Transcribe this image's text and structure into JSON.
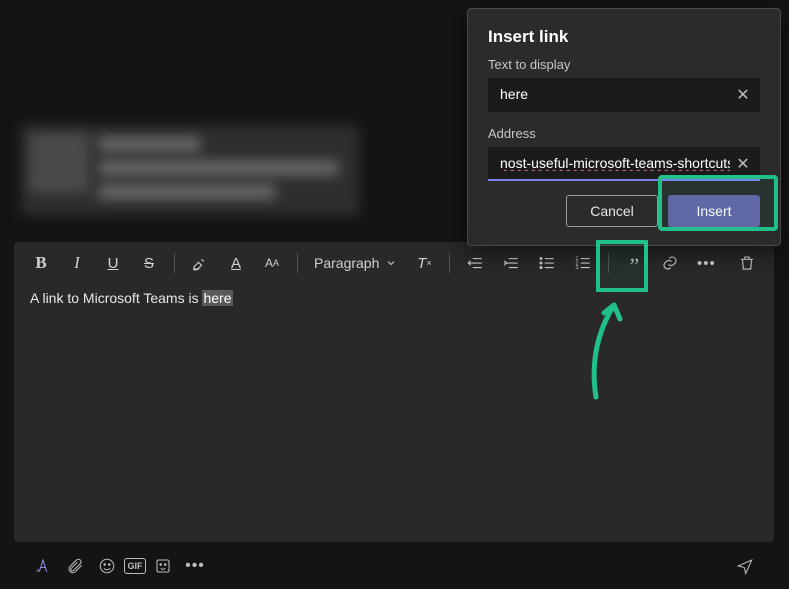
{
  "header_blur": true,
  "dialog": {
    "title": "Insert link",
    "text_label": "Text to display",
    "text_value": "here",
    "address_label": "Address",
    "address_value": "nost-useful-microsoft-teams-shortcuts/",
    "cancel_label": "Cancel",
    "insert_label": "Insert"
  },
  "toolbar": {
    "paragraph_label": "Paragraph"
  },
  "editor": {
    "text_before": "A link to Microsoft Teams is ",
    "selected_text": "here"
  },
  "annotation": {
    "highlight_insert": true,
    "highlight_link_icon": true,
    "arrow_to_link": true
  }
}
